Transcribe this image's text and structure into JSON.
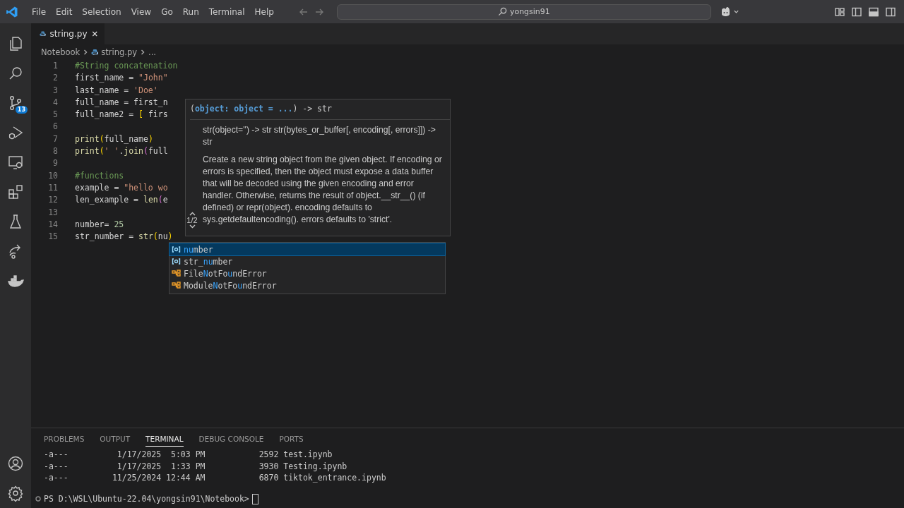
{
  "title_bar": {
    "menu": [
      "File",
      "Edit",
      "Selection",
      "View",
      "Go",
      "Run",
      "Terminal",
      "Help"
    ],
    "search": {
      "value": "yongsin91"
    }
  },
  "activity_bar": {
    "top": [
      {
        "kind": "explorer"
      },
      {
        "kind": "search"
      },
      {
        "kind": "source-control",
        "badge": "13"
      },
      {
        "kind": "run-debug"
      },
      {
        "kind": "remote"
      },
      {
        "kind": "extensions"
      },
      {
        "kind": "testing"
      },
      {
        "kind": "share"
      },
      {
        "kind": "docker"
      }
    ],
    "bottom": [
      {
        "kind": "account"
      },
      {
        "kind": "settings"
      }
    ]
  },
  "editor": {
    "tab": {
      "label": "string.py"
    },
    "breadcrumb": [
      "Notebook",
      "string.py",
      "..."
    ],
    "lines": [
      {
        "number": "1",
        "segments": [
          {
            "kind": "comment",
            "text": "#String concatenation"
          }
        ]
      },
      {
        "number": "2",
        "segments": [
          {
            "kind": "var",
            "text": "first_name"
          },
          {
            "kind": "op",
            "text": " = "
          },
          {
            "kind": "str",
            "text": "\"John\""
          }
        ]
      },
      {
        "number": "3",
        "segments": [
          {
            "kind": "var",
            "text": "last_name"
          },
          {
            "kind": "op",
            "text": " = "
          },
          {
            "kind": "str",
            "text": "'Doe'"
          }
        ]
      },
      {
        "number": "4",
        "segments": [
          {
            "kind": "var",
            "text": "full_name"
          },
          {
            "kind": "op",
            "text": " = "
          },
          {
            "kind": "var",
            "text": "first_n"
          }
        ]
      },
      {
        "number": "5",
        "segments": [
          {
            "kind": "var",
            "text": "full_name2"
          },
          {
            "kind": "op",
            "text": " = "
          },
          {
            "kind": "bracket",
            "text": "["
          },
          {
            "kind": "var",
            "text": " firs"
          }
        ]
      },
      {
        "number": "6"
      },
      {
        "number": "7",
        "segments": [
          {
            "kind": "func",
            "text": "print"
          },
          {
            "kind": "bracket",
            "text": "("
          },
          {
            "kind": "var",
            "text": "full_name"
          },
          {
            "kind": "bracket",
            "text": ")"
          }
        ]
      },
      {
        "number": "8",
        "segments": [
          {
            "kind": "func",
            "text": "print"
          },
          {
            "kind": "bracket",
            "text": "("
          },
          {
            "kind": "str",
            "text": "' '"
          },
          {
            "kind": "op",
            "text": "."
          },
          {
            "kind": "func",
            "text": "join"
          },
          {
            "kind": "bracket2",
            "text": "("
          },
          {
            "kind": "var",
            "text": "full"
          }
        ]
      },
      {
        "number": "9"
      },
      {
        "number": "10",
        "segments": [
          {
            "kind": "comment",
            "text": "#functions"
          }
        ]
      },
      {
        "number": "11",
        "segments": [
          {
            "kind": "var",
            "text": "example"
          },
          {
            "kind": "op",
            "text": " = "
          },
          {
            "kind": "str",
            "text": "\"hello wo"
          }
        ]
      },
      {
        "number": "12",
        "segments": [
          {
            "kind": "var",
            "text": "len_example"
          },
          {
            "kind": "op",
            "text": " = "
          },
          {
            "kind": "func",
            "text": "len"
          },
          {
            "kind": "bracket2",
            "text": "("
          },
          {
            "kind": "var",
            "text": "e"
          }
        ]
      },
      {
        "number": "13"
      },
      {
        "number": "14",
        "segments": [
          {
            "kind": "var",
            "text": "number"
          },
          {
            "kind": "op",
            "text": "= "
          },
          {
            "kind": "num",
            "text": "25"
          }
        ]
      },
      {
        "number": "15",
        "segments": [
          {
            "kind": "var",
            "text": "str_number"
          },
          {
            "kind": "op",
            "text": " = "
          },
          {
            "kind": "func",
            "text": "str"
          },
          {
            "kind": "bracket",
            "text": "("
          },
          {
            "kind": "var",
            "text": "nu"
          },
          {
            "kind": "bracket",
            "text": ")"
          }
        ]
      }
    ],
    "hover": {
      "signature": "(**object: object = ...**) -> str",
      "counter": "1/2",
      "docs": [
        "str(object='') -> str str(bytes_or_buffer[, encoding[, errors]]) -> str",
        "Create a new string object from the given object. If encoding or errors is specified, then the object must expose a data buffer that will be decoded using the given encoding and error handler. Otherwise, returns the result of object.__str__() (if defined) or repr(object). encoding defaults to sys.getdefaultencoding(). errors defaults to 'strict'."
      ]
    },
    "suggestions": [
      {
        "label": "**nu**mber",
        "kind": "variable",
        "selected": true
      },
      {
        "label": "str_**nu**mber",
        "kind": "variable",
        "selected": false
      },
      {
        "label": "File**N**otFo**u**ndError",
        "kind": "class",
        "selected": false
      },
      {
        "label": "Module**N**otFo**u**ndError",
        "kind": "class",
        "selected": false
      }
    ]
  },
  "panel": {
    "tabs": [
      {
        "label": "PROBLEMS",
        "selected": false
      },
      {
        "label": "OUTPUT",
        "selected": false
      },
      {
        "label": "TERMINAL",
        "selected": true
      },
      {
        "label": "DEBUG CONSOLE",
        "selected": false
      },
      {
        "label": "PORTS",
        "selected": false
      }
    ],
    "terminal_lines": [
      "-a---          1/17/2025  5:03 PM           2592 test.ipynb",
      "-a---          1/17/2025  1:33 PM           3930 Testing.ipynb",
      "-a---         11/25/2024 12:44 AM           6870 tiktok_entrance.ipynb"
    ],
    "prompt": "PS D:\\WSL\\Ubuntu-22.04\\yongsin91\\Notebook>"
  }
}
